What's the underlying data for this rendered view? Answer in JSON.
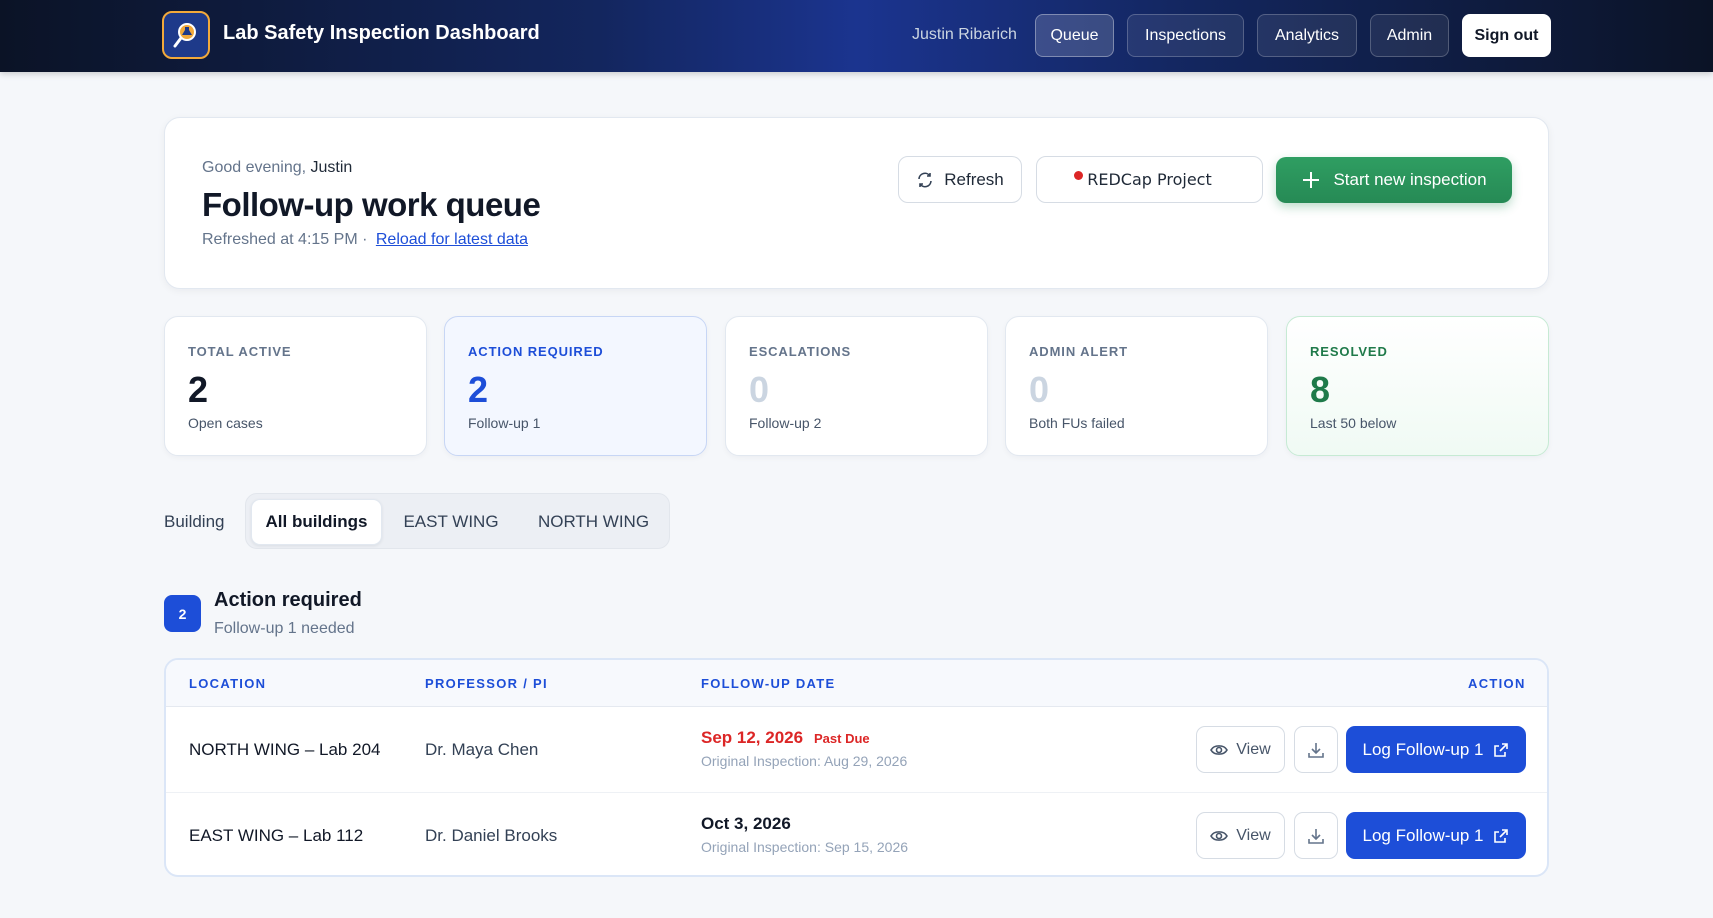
{
  "app": {
    "title": "Lab Safety Inspection Dashboard",
    "user_name": "Justin Ribarich",
    "nav": [
      {
        "label": "Queue",
        "active": true
      },
      {
        "label": "Inspections",
        "active": false
      },
      {
        "label": "Analytics",
        "active": false
      },
      {
        "label": "Admin",
        "active": false
      }
    ],
    "sign_out_label": "Sign out",
    "logo_icon": "flask-magnifier-icon"
  },
  "header": {
    "greeting_prefix": "Good evening,",
    "greeting_name": "Justin",
    "title": "Follow-up work queue",
    "refreshed_text": "Refreshed at 4:15 PM ·",
    "reload_link": "Reload for latest data",
    "refresh_label": "Refresh",
    "redcap_label": "REDCap Project",
    "start_label": "Start new inspection"
  },
  "stats": [
    {
      "label": "TOTAL ACTIVE",
      "value": "2",
      "sub": "Open cases"
    },
    {
      "label": "ACTION REQUIRED",
      "value": "2",
      "sub": "Follow-up 1"
    },
    {
      "label": "ESCALATIONS",
      "value": "0",
      "sub": "Follow-up 2"
    },
    {
      "label": "ADMIN ALERT",
      "value": "0",
      "sub": "Both FUs failed"
    },
    {
      "label": "RESOLVED",
      "value": "8",
      "sub": "Last 50 below"
    }
  ],
  "filter": {
    "label": "Building",
    "options": [
      "All buildings",
      "EAST WING",
      "NORTH WING"
    ],
    "selected": "All buildings"
  },
  "section": {
    "count": "2",
    "title": "Action required",
    "subtitle": "Follow-up 1 needed"
  },
  "table": {
    "columns": [
      "LOCATION",
      "PROFESSOR / PI",
      "FOLLOW-UP DATE",
      "ACTION"
    ],
    "rows": [
      {
        "location": "NORTH WING – Lab 204",
        "pi": "Dr. Maya Chen",
        "followup_date": "Sep 12, 2026",
        "past_due": "Past Due",
        "original": "Original Inspection: Aug 29, 2026",
        "view_label": "View",
        "log_label": "Log Follow-up 1"
      },
      {
        "location": "EAST WING – Lab 112",
        "pi": "Dr. Daniel Brooks",
        "followup_date": "Oct 3, 2026",
        "past_due": "",
        "original": "Original Inspection: Sep 15, 2026",
        "view_label": "View",
        "log_label": "Log Follow-up 1"
      }
    ]
  },
  "colors": {
    "accent": "#1d4ed8",
    "success": "#2f9e62",
    "danger": "#dc2626"
  }
}
